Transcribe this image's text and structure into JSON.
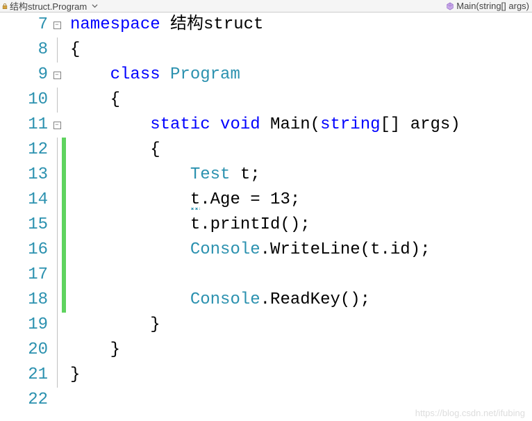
{
  "breadcrumb": {
    "left": "结构struct.Program",
    "right": "Main(string[] args)"
  },
  "lines": [
    {
      "num": 7,
      "fold": "box",
      "mod": false,
      "tokens": [
        {
          "t": "keyword",
          "v": "namespace"
        },
        {
          "t": "default",
          "v": " 结构struct"
        }
      ]
    },
    {
      "num": 8,
      "fold": "line",
      "mod": false,
      "tokens": [
        {
          "t": "default",
          "v": "{"
        }
      ]
    },
    {
      "num": 9,
      "fold": "box",
      "mod": false,
      "tokens": [
        {
          "t": "default",
          "v": "    "
        },
        {
          "t": "keyword",
          "v": "class"
        },
        {
          "t": "default",
          "v": " "
        },
        {
          "t": "type",
          "v": "Program"
        }
      ]
    },
    {
      "num": 10,
      "fold": "line",
      "mod": false,
      "tokens": [
        {
          "t": "default",
          "v": "    {"
        }
      ]
    },
    {
      "num": 11,
      "fold": "box",
      "mod": false,
      "tokens": [
        {
          "t": "default",
          "v": "        "
        },
        {
          "t": "keyword",
          "v": "static"
        },
        {
          "t": "default",
          "v": " "
        },
        {
          "t": "keyword",
          "v": "void"
        },
        {
          "t": "default",
          "v": " Main("
        },
        {
          "t": "keyword",
          "v": "string"
        },
        {
          "t": "default",
          "v": "[] args)"
        }
      ]
    },
    {
      "num": 12,
      "fold": "line",
      "mod": true,
      "tokens": [
        {
          "t": "default",
          "v": "        {"
        }
      ]
    },
    {
      "num": 13,
      "fold": "line",
      "mod": true,
      "tokens": [
        {
          "t": "default",
          "v": "            "
        },
        {
          "t": "type",
          "v": "Test"
        },
        {
          "t": "default",
          "v": " t;"
        }
      ]
    },
    {
      "num": 14,
      "fold": "line",
      "mod": true,
      "tokens": [
        {
          "t": "default",
          "v": "            "
        },
        {
          "t": "default",
          "v": "t",
          "squiggle": true
        },
        {
          "t": "default",
          "v": ".Age = 13;"
        }
      ]
    },
    {
      "num": 15,
      "fold": "line",
      "mod": true,
      "tokens": [
        {
          "t": "default",
          "v": "            t.printId();"
        }
      ]
    },
    {
      "num": 16,
      "fold": "line",
      "mod": true,
      "tokens": [
        {
          "t": "default",
          "v": "            "
        },
        {
          "t": "type",
          "v": "Console"
        },
        {
          "t": "default",
          "v": ".WriteLine(t.id);"
        }
      ]
    },
    {
      "num": 17,
      "fold": "line",
      "mod": true,
      "tokens": []
    },
    {
      "num": 18,
      "fold": "line",
      "mod": true,
      "tokens": [
        {
          "t": "default",
          "v": "            "
        },
        {
          "t": "type",
          "v": "Console"
        },
        {
          "t": "default",
          "v": ".ReadKey();"
        }
      ]
    },
    {
      "num": 19,
      "fold": "line",
      "mod": false,
      "tokens": [
        {
          "t": "default",
          "v": "        }"
        }
      ]
    },
    {
      "num": 20,
      "fold": "line",
      "mod": false,
      "tokens": [
        {
          "t": "default",
          "v": "    }"
        }
      ]
    },
    {
      "num": 21,
      "fold": "line",
      "mod": false,
      "tokens": [
        {
          "t": "default",
          "v": "}"
        }
      ]
    },
    {
      "num": 22,
      "fold": "",
      "mod": false,
      "tokens": []
    }
  ],
  "watermark": "https://blog.csdn.net/ifubing"
}
